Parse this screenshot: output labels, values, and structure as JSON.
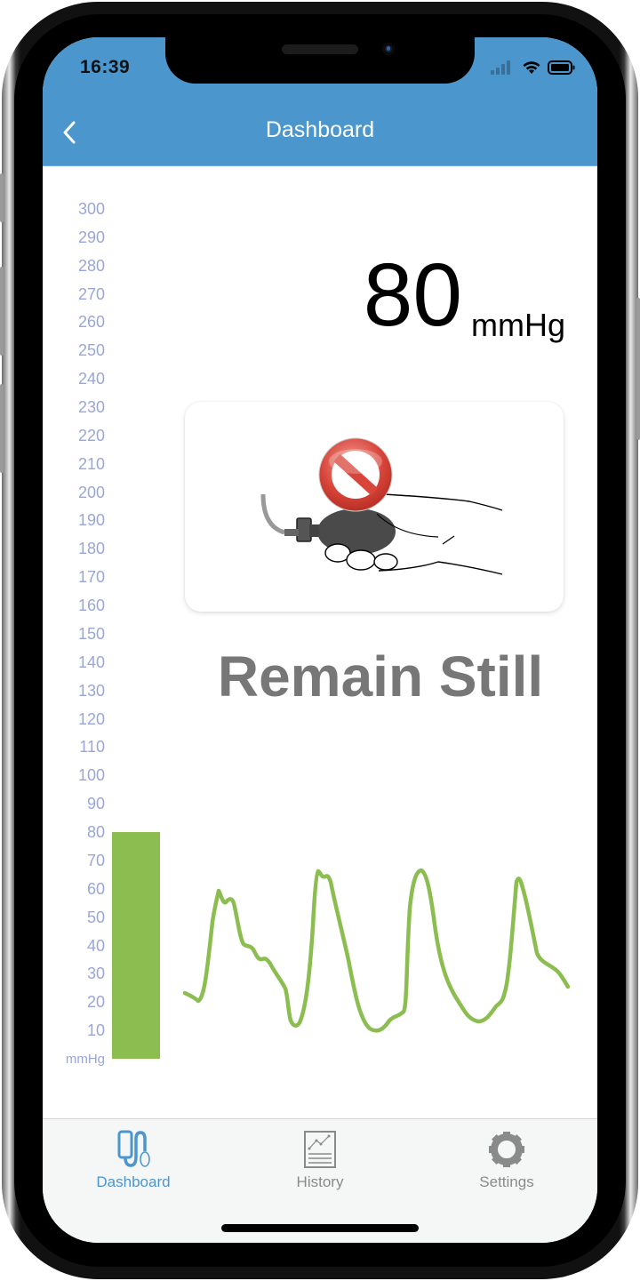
{
  "status_bar": {
    "time": "16:39",
    "icons": [
      "cellular-signal-icon",
      "wifi-icon",
      "battery-icon"
    ]
  },
  "header": {
    "title": "Dashboard",
    "back_icon": "chevron-left-icon",
    "background_color": "#4b96cd"
  },
  "gauge": {
    "axis_labels": [
      "300",
      "290",
      "280",
      "270",
      "260",
      "250",
      "240",
      "230",
      "220",
      "210",
      "200",
      "190",
      "180",
      "170",
      "160",
      "150",
      "140",
      "130",
      "120",
      "110",
      "100",
      "90",
      "80",
      "70",
      "60",
      "50",
      "40",
      "30",
      "20",
      "10"
    ],
    "unit_label": "mmHg",
    "current_pressure": 80,
    "max_pressure": 300,
    "bar_color": "#8bbd50"
  },
  "reading": {
    "value": "80",
    "unit": "mmHg"
  },
  "instruction_card": {
    "illustration": "hand-holding-inflation-bulb-with-prohibited-sign",
    "icon": "prohibited-icon"
  },
  "instruction_text": "Remain Still",
  "waveform": {
    "color": "#8bbd50",
    "description": "oscillometric pulse waveform"
  },
  "tabbar": {
    "tabs": [
      {
        "label": "Dashboard",
        "icon": "blood-pressure-cuff-icon",
        "active": true,
        "color": "#4b96cd"
      },
      {
        "label": "History",
        "icon": "chart-document-icon",
        "active": false,
        "color": "#8a8a8a"
      },
      {
        "label": "Settings",
        "icon": "gear-icon",
        "active": false,
        "color": "#8a8a8a"
      }
    ]
  }
}
